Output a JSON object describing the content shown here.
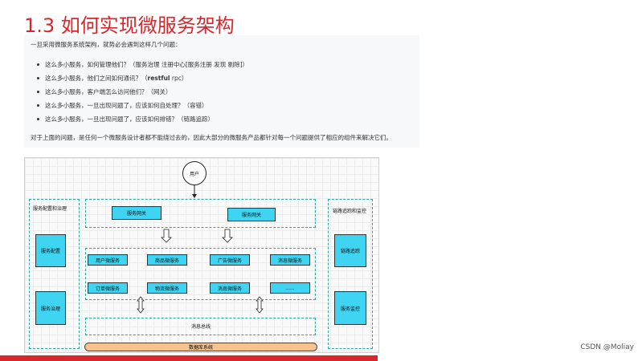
{
  "slide": {
    "title": "1.3 如何实现微服务架构"
  },
  "text": {
    "intro": "一旦采用微服务系统架构，就势必会遇到这样几个问题：",
    "bullets": [
      {
        "main": "这么多小服务，如何管理他们？（服务治理 注册中心[服务注册 发现 剔除]）",
        "bold": "",
        "after": ""
      },
      {
        "main": "这么多小服务，他们之间如何通讯？（",
        "bold": "restful",
        "after": " rpc）"
      },
      {
        "main": "这么多小服务，客户端怎么访问他们？（网关）",
        "bold": "",
        "after": ""
      },
      {
        "main": "这么多小服务，一旦出现问题了，应该如何自处理？（容错）",
        "bold": "",
        "after": ""
      },
      {
        "main": "这么多小服务，一旦出现问题了，应该如何排错？（链路追踪）",
        "bold": "",
        "after": ""
      }
    ],
    "summary": "对于上面的问题，是任何一个微服务设计者都不能绕过去的，因此大部分的微服务产品都针对每一个问题提供了相应的组件来解决它们。"
  },
  "diagram": {
    "user": "用户",
    "left_panel": {
      "title": "服务配置和治理",
      "items": [
        "服务配置",
        "服务治理"
      ]
    },
    "right_panel": {
      "title": "链路追踪和监控",
      "items": [
        "链路追踪",
        "服务监控"
      ]
    },
    "gateways": [
      "服务网关",
      "服务网关"
    ],
    "services_row1": [
      "用户微服务",
      "商品微服务",
      "广告微服务",
      "消息微服务"
    ],
    "services_row2": [
      "订单微服务",
      "物流微服务",
      "消息微服务",
      "......"
    ],
    "bus": "消息总线",
    "db": "数据库系统"
  },
  "footer": {
    "watermark": "CSDN @Moliay"
  },
  "colors": {
    "title": "#d9262c",
    "node": "#3ed4f2",
    "dashed": "#2aa7a7",
    "db": "#f6c38f"
  }
}
